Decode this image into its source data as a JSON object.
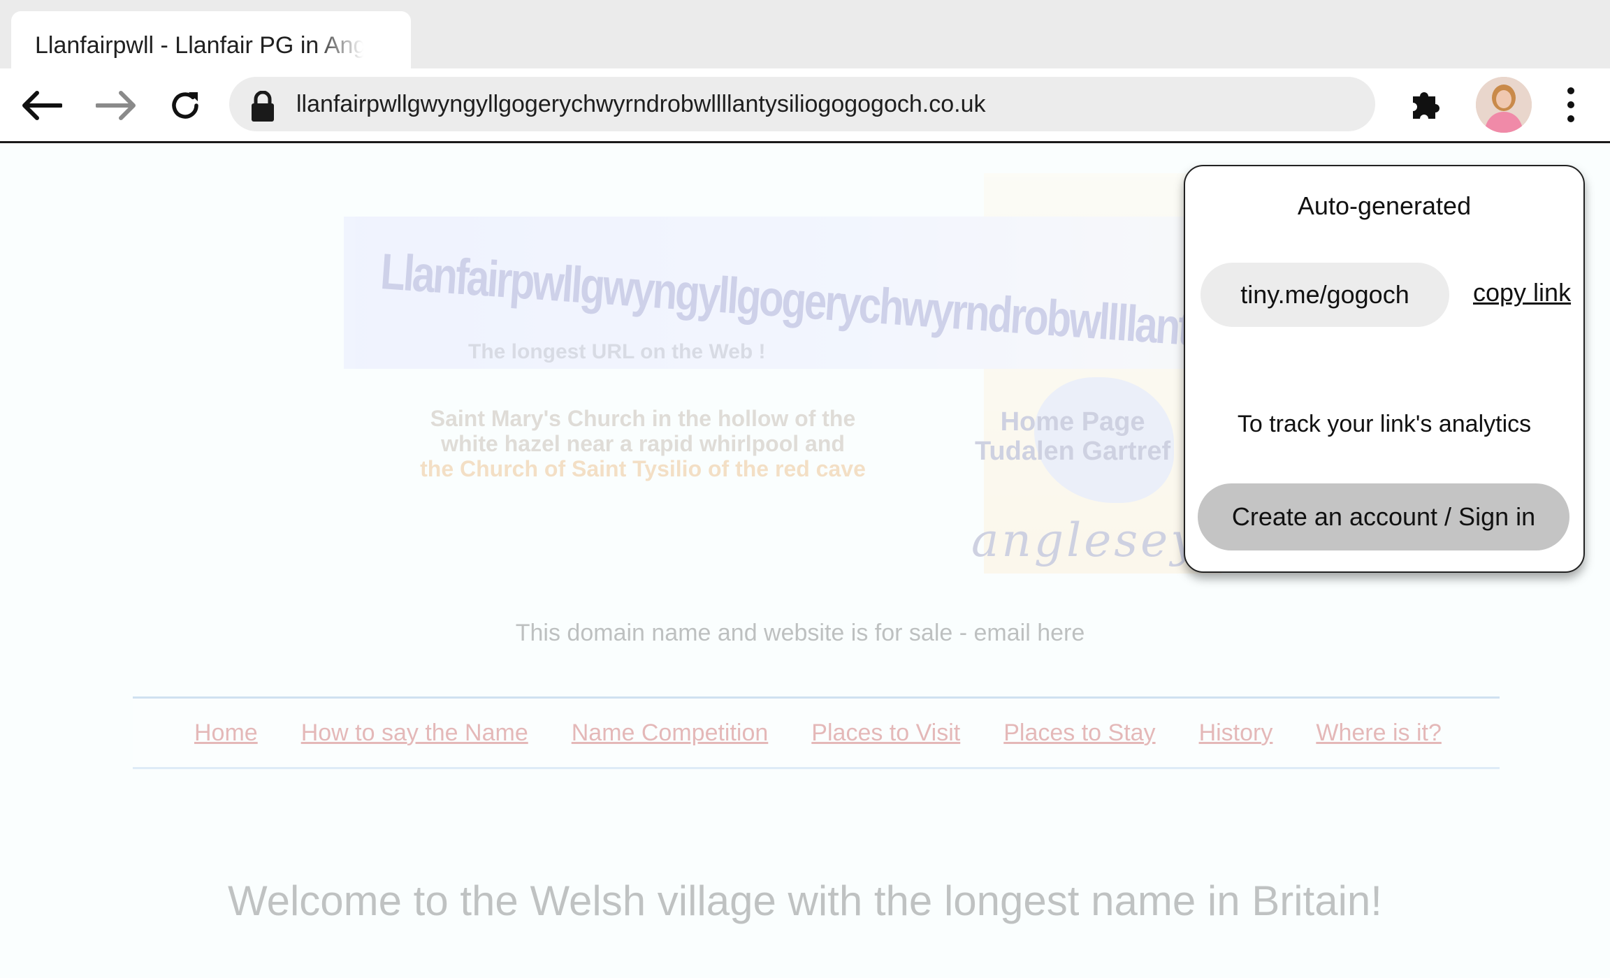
{
  "browser": {
    "tab_title": "Llanfairpwll - Llanfair PG in Anglesey",
    "url": "llanfairpwllgwyngyllgogerychwyrndrobwllllantysiliogogogoch.co.uk",
    "icons": [
      "back-arrow-icon",
      "forward-arrow-icon",
      "reload-icon",
      "lock-icon",
      "puzzle-extension-icon",
      "profile-avatar",
      "kebab-menu-icon"
    ]
  },
  "page": {
    "banner_title": "Llanfairpwllgwyngyllgogerychwyrndrobwllllantysiliogogogoch",
    "banner_subtitle": "The longest URL on the Web !",
    "church_line1": "Saint Mary's Church in the hollow of the",
    "church_line2": "white hazel near a rapid whirlpool and",
    "church_line3": "the Church of Saint Tysilio of the red cave",
    "home_line1": "Home Page",
    "home_line2": "Tudalen Gartref",
    "anglesey": "anglesey",
    "for_sale": "This domain name and website is for sale - email here",
    "nav": [
      "Home",
      "How to say the Name",
      "Name Competition",
      "Places to Visit",
      "Places to Stay",
      "History",
      "Where is it?"
    ],
    "welcome": "Welcome to the Welsh village with the longest name in Britain!"
  },
  "popup": {
    "title": "Auto-generated",
    "short_link": "tiny.me/gogoch",
    "copy_label": "copy link",
    "track_text": "To track your link's analytics",
    "cta_label": "Create an account / Sign in"
  }
}
